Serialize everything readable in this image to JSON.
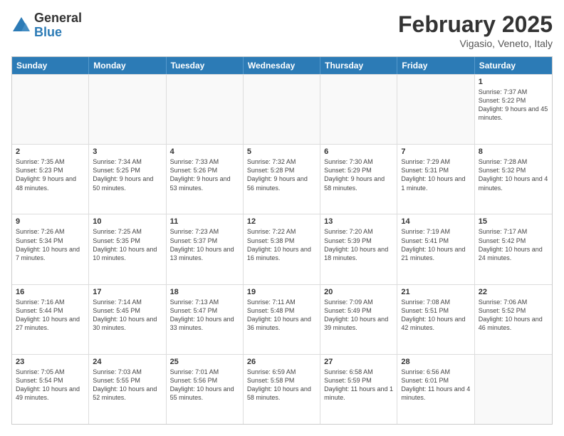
{
  "logo": {
    "general": "General",
    "blue": "Blue"
  },
  "header": {
    "month": "February 2025",
    "location": "Vigasio, Veneto, Italy"
  },
  "dayHeaders": [
    "Sunday",
    "Monday",
    "Tuesday",
    "Wednesday",
    "Thursday",
    "Friday",
    "Saturday"
  ],
  "weeks": [
    [
      {
        "num": "",
        "info": ""
      },
      {
        "num": "",
        "info": ""
      },
      {
        "num": "",
        "info": ""
      },
      {
        "num": "",
        "info": ""
      },
      {
        "num": "",
        "info": ""
      },
      {
        "num": "",
        "info": ""
      },
      {
        "num": "1",
        "info": "Sunrise: 7:37 AM\nSunset: 5:22 PM\nDaylight: 9 hours and 45 minutes."
      }
    ],
    [
      {
        "num": "2",
        "info": "Sunrise: 7:35 AM\nSunset: 5:23 PM\nDaylight: 9 hours and 48 minutes."
      },
      {
        "num": "3",
        "info": "Sunrise: 7:34 AM\nSunset: 5:25 PM\nDaylight: 9 hours and 50 minutes."
      },
      {
        "num": "4",
        "info": "Sunrise: 7:33 AM\nSunset: 5:26 PM\nDaylight: 9 hours and 53 minutes."
      },
      {
        "num": "5",
        "info": "Sunrise: 7:32 AM\nSunset: 5:28 PM\nDaylight: 9 hours and 56 minutes."
      },
      {
        "num": "6",
        "info": "Sunrise: 7:30 AM\nSunset: 5:29 PM\nDaylight: 9 hours and 58 minutes."
      },
      {
        "num": "7",
        "info": "Sunrise: 7:29 AM\nSunset: 5:31 PM\nDaylight: 10 hours and 1 minute."
      },
      {
        "num": "8",
        "info": "Sunrise: 7:28 AM\nSunset: 5:32 PM\nDaylight: 10 hours and 4 minutes."
      }
    ],
    [
      {
        "num": "9",
        "info": "Sunrise: 7:26 AM\nSunset: 5:34 PM\nDaylight: 10 hours and 7 minutes."
      },
      {
        "num": "10",
        "info": "Sunrise: 7:25 AM\nSunset: 5:35 PM\nDaylight: 10 hours and 10 minutes."
      },
      {
        "num": "11",
        "info": "Sunrise: 7:23 AM\nSunset: 5:37 PM\nDaylight: 10 hours and 13 minutes."
      },
      {
        "num": "12",
        "info": "Sunrise: 7:22 AM\nSunset: 5:38 PM\nDaylight: 10 hours and 16 minutes."
      },
      {
        "num": "13",
        "info": "Sunrise: 7:20 AM\nSunset: 5:39 PM\nDaylight: 10 hours and 18 minutes."
      },
      {
        "num": "14",
        "info": "Sunrise: 7:19 AM\nSunset: 5:41 PM\nDaylight: 10 hours and 21 minutes."
      },
      {
        "num": "15",
        "info": "Sunrise: 7:17 AM\nSunset: 5:42 PM\nDaylight: 10 hours and 24 minutes."
      }
    ],
    [
      {
        "num": "16",
        "info": "Sunrise: 7:16 AM\nSunset: 5:44 PM\nDaylight: 10 hours and 27 minutes."
      },
      {
        "num": "17",
        "info": "Sunrise: 7:14 AM\nSunset: 5:45 PM\nDaylight: 10 hours and 30 minutes."
      },
      {
        "num": "18",
        "info": "Sunrise: 7:13 AM\nSunset: 5:47 PM\nDaylight: 10 hours and 33 minutes."
      },
      {
        "num": "19",
        "info": "Sunrise: 7:11 AM\nSunset: 5:48 PM\nDaylight: 10 hours and 36 minutes."
      },
      {
        "num": "20",
        "info": "Sunrise: 7:09 AM\nSunset: 5:49 PM\nDaylight: 10 hours and 39 minutes."
      },
      {
        "num": "21",
        "info": "Sunrise: 7:08 AM\nSunset: 5:51 PM\nDaylight: 10 hours and 42 minutes."
      },
      {
        "num": "22",
        "info": "Sunrise: 7:06 AM\nSunset: 5:52 PM\nDaylight: 10 hours and 46 minutes."
      }
    ],
    [
      {
        "num": "23",
        "info": "Sunrise: 7:05 AM\nSunset: 5:54 PM\nDaylight: 10 hours and 49 minutes."
      },
      {
        "num": "24",
        "info": "Sunrise: 7:03 AM\nSunset: 5:55 PM\nDaylight: 10 hours and 52 minutes."
      },
      {
        "num": "25",
        "info": "Sunrise: 7:01 AM\nSunset: 5:56 PM\nDaylight: 10 hours and 55 minutes."
      },
      {
        "num": "26",
        "info": "Sunrise: 6:59 AM\nSunset: 5:58 PM\nDaylight: 10 hours and 58 minutes."
      },
      {
        "num": "27",
        "info": "Sunrise: 6:58 AM\nSunset: 5:59 PM\nDaylight: 11 hours and 1 minute."
      },
      {
        "num": "28",
        "info": "Sunrise: 6:56 AM\nSunset: 6:01 PM\nDaylight: 11 hours and 4 minutes."
      },
      {
        "num": "",
        "info": ""
      }
    ]
  ]
}
